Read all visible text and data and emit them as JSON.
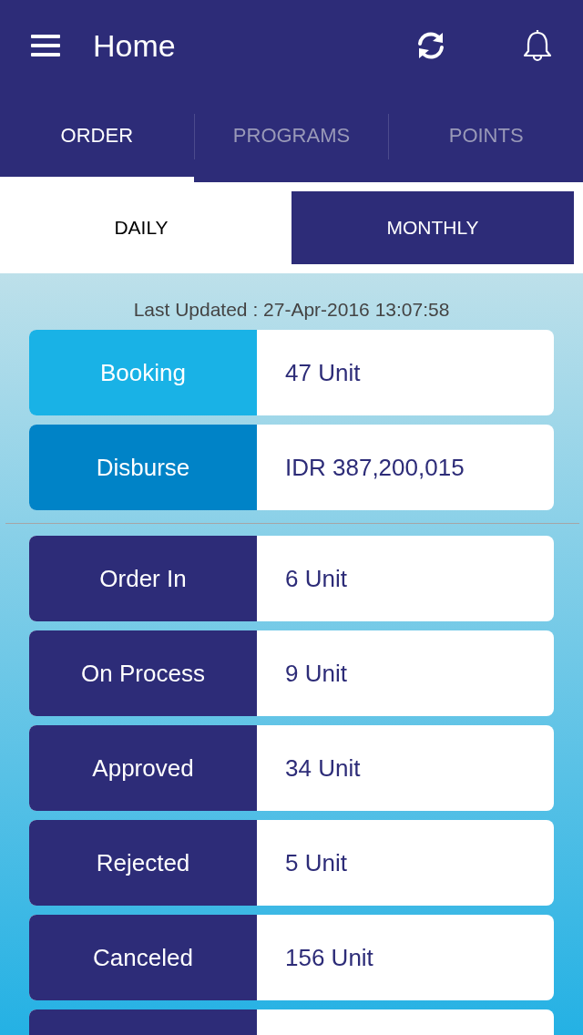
{
  "header": {
    "title": "Home"
  },
  "tabs": [
    {
      "label": "ORDER",
      "selected": true
    },
    {
      "label": "PROGRAMS",
      "selected": false
    },
    {
      "label": "POINTS",
      "selected": false
    }
  ],
  "periods": [
    {
      "label": "DAILY",
      "selected": false
    },
    {
      "label": "MONTHLY",
      "selected": true
    }
  ],
  "last_updated": "Last Updated : 27-Apr-2016 13:07:58",
  "summary": [
    {
      "label": "Booking",
      "value": "47 Unit",
      "color": "#19b2e6"
    },
    {
      "label": "Disburse",
      "value": "IDR 387,200,015",
      "color": "#0083c7"
    }
  ],
  "statuses": [
    {
      "label": "Order In",
      "value": "6 Unit"
    },
    {
      "label": "On Process",
      "value": "9 Unit"
    },
    {
      "label": "Approved",
      "value": "34 Unit"
    },
    {
      "label": "Rejected",
      "value": "5 Unit"
    },
    {
      "label": "Canceled",
      "value": "156 Unit"
    }
  ]
}
